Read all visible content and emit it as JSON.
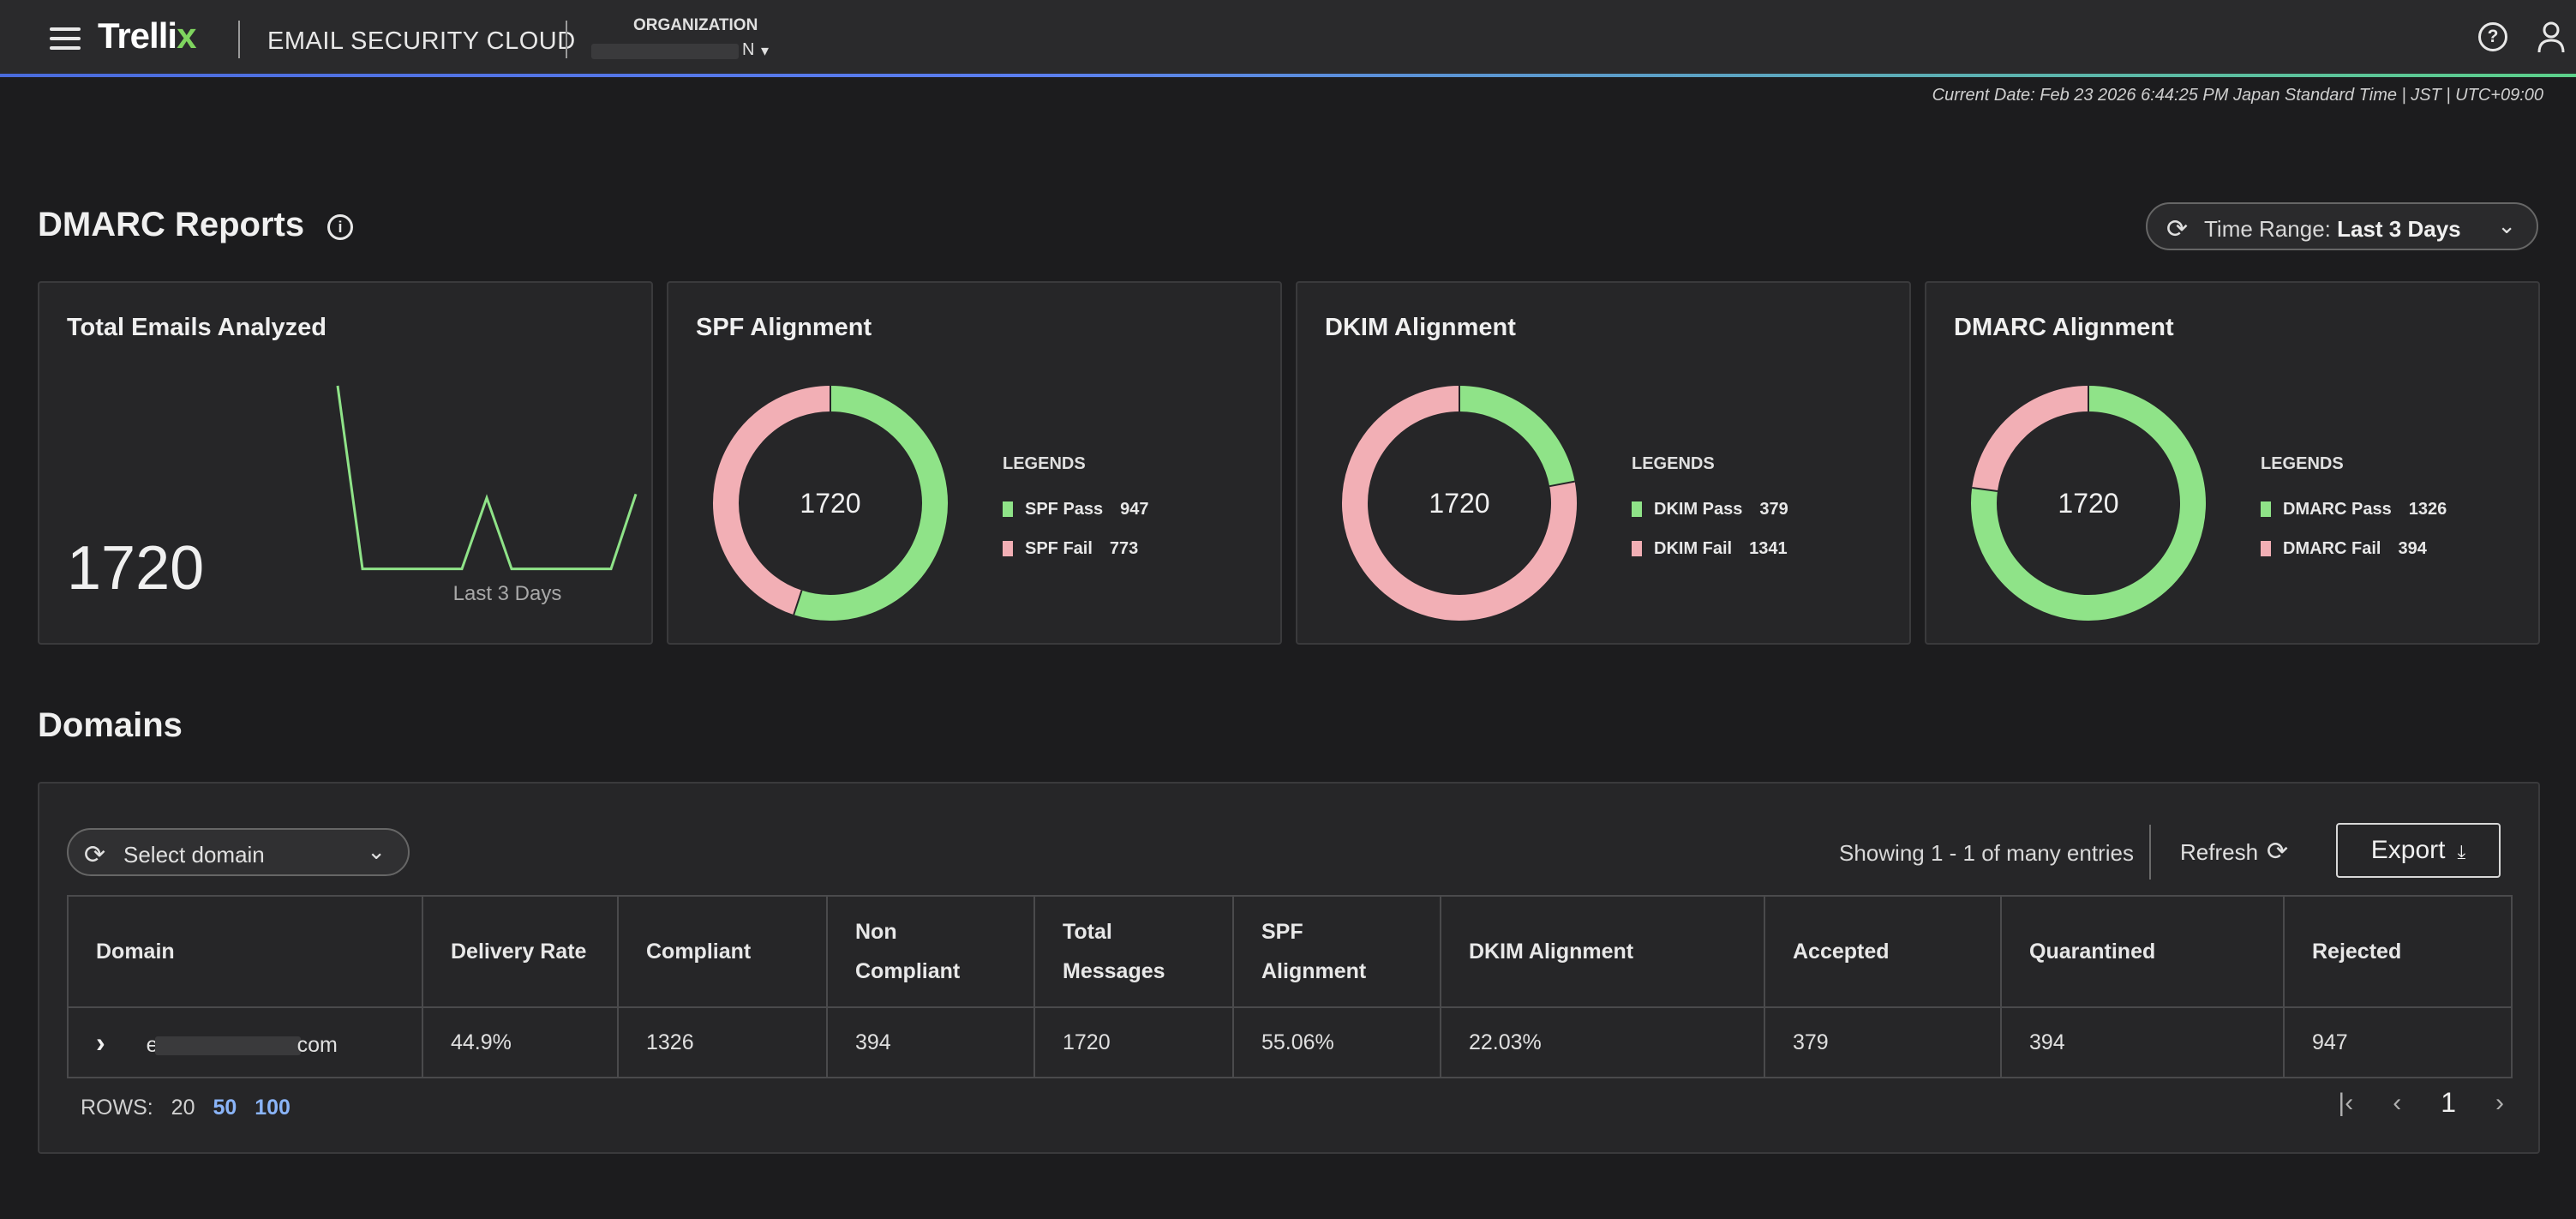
{
  "header": {
    "logo_text": "Trelli",
    "logo_x": "x",
    "product_name": "EMAIL SECURITY CLOUD",
    "org_label": "ORGANIZATION",
    "org_value_suffix": "N",
    "current_date": "Current Date: Feb 23 2026 6:44:25 PM Japan Standard Time | JST | UTC+09:00"
  },
  "page": {
    "title": "DMARC Reports",
    "time_range_label": "Time Range:",
    "time_range_value": "Last 3 Days"
  },
  "cards": {
    "total": {
      "title": "Total Emails Analyzed",
      "value": "1720",
      "caption": "Last 3 Days"
    },
    "spf": {
      "title": "SPF Alignment",
      "center": "1720",
      "legend_title": "LEGENDS",
      "pass_label": "SPF Pass",
      "pass_value": "947",
      "fail_label": "SPF Fail",
      "fail_value": "773"
    },
    "dkim": {
      "title": "DKIM Alignment",
      "center": "1720",
      "legend_title": "LEGENDS",
      "pass_label": "DKIM Pass",
      "pass_value": "379",
      "fail_label": "DKIM Fail",
      "fail_value": "1341"
    },
    "dmarc": {
      "title": "DMARC Alignment",
      "center": "1720",
      "legend_title": "LEGENDS",
      "pass_label": "DMARC Pass",
      "pass_value": "1326",
      "fail_label": "DMARC Fail",
      "fail_value": "394"
    }
  },
  "colors": {
    "pass": "#8fe388",
    "fail": "#f2afb5",
    "accent_blue": "#8ab4f8"
  },
  "chart_data": [
    {
      "type": "line",
      "title": "Total Emails Analyzed",
      "xlabel": "Last 3 Days",
      "series": [
        {
          "values": [
            1.0,
            0.02,
            0.02,
            0.02,
            0.02,
            0.02,
            0.4,
            0.02,
            0.02,
            0.02,
            0.02,
            0.02,
            0.42
          ]
        }
      ]
    },
    {
      "type": "pie",
      "title": "SPF Alignment",
      "labels": [
        "SPF Pass",
        "SPF Fail"
      ],
      "values": [
        947,
        773
      ]
    },
    {
      "type": "pie",
      "title": "DKIM Alignment",
      "labels": [
        "DKIM Pass",
        "DKIM Fail"
      ],
      "values": [
        379,
        1341
      ]
    },
    {
      "type": "pie",
      "title": "DMARC Alignment",
      "labels": [
        "DMARC Pass",
        "DMARC Fail"
      ],
      "values": [
        1326,
        394
      ]
    }
  ],
  "domains": {
    "title": "Domains",
    "select_placeholder": "Select domain",
    "showing": "Showing 1 - 1 of many entries",
    "refresh_label": "Refresh",
    "export_label": "Export",
    "columns": [
      "Domain",
      "Delivery Rate",
      "Compliant",
      "Non Compliant",
      "Total Messages",
      "SPF Alignment",
      "DKIM Alignment",
      "Accepted",
      "Quarantined",
      "Rejected"
    ],
    "rows": [
      {
        "domain_prefix": "e",
        "domain_suffix": "com",
        "delivery_rate": "44.9%",
        "compliant": "1326",
        "non_compliant": "394",
        "total_messages": "1720",
        "spf": "55.06%",
        "dkim": "22.03%",
        "accepted": "379",
        "quarantined": "394",
        "rejected": "947"
      }
    ],
    "rows_label": "ROWS:",
    "row_options": [
      "20",
      "50",
      "100"
    ],
    "page_number": "1"
  }
}
